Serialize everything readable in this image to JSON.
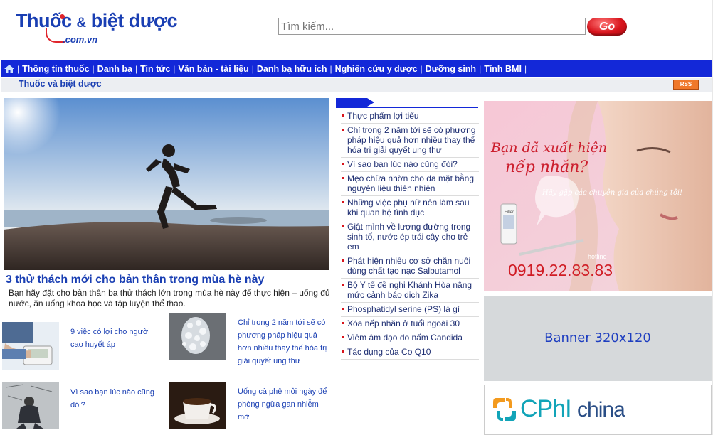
{
  "header": {
    "logo_brand": "Thuốc",
    "logo_amp": "&",
    "logo_rest": "biệt dược",
    "logo_sub": ".com.vn",
    "search_placeholder": "Tìm kiếm...",
    "search_button": "Go"
  },
  "nav": {
    "home_icon": "home-icon",
    "items": [
      "Thông tin thuốc",
      "Danh bạ",
      "Tin tức",
      "Văn bản - tài liệu",
      "Danh bạ hữu ích",
      "Nghiên cứu y dược",
      "Dưỡng sinh",
      "Tính BMI"
    ]
  },
  "breadcrumb": "Thuốc và biệt dược",
  "rss": "RSS",
  "feature": {
    "title": "3 thử thách mới cho bản thân trong mùa hè này",
    "summary": "Bạn hãy đặt cho bản thân ba thử thách lớn trong mùa hè này để thực hiện – uống đủ nước, ăn uống khoa học và tập luyện thể thao."
  },
  "small_articles": [
    {
      "title": "9 việc có lợi cho người cao huyết áp"
    },
    {
      "title": "Chỉ trong 2 năm tới sẽ có phương pháp hiệu quả hơn nhiều thay thế hóa trị giải quyết ung thư"
    },
    {
      "title": "Vì sao bạn lúc nào cũng đói?"
    },
    {
      "title": "Uống cà phê mỗi ngày để phòng ngừa gan nhiễm mỡ"
    }
  ],
  "news_list": [
    "Thực phẩm lợi tiểu",
    "Chỉ trong 2 năm tới sẽ có phương pháp hiệu quả hơn nhiều thay thế hóa trị giải quyết ung thư",
    "Vì sao bạn lúc nào cũng đói?",
    "Mẹo chữa nhờn cho da mặt bằng nguyên liệu thiên nhiên",
    "Những việc phụ nữ nên làm sau khi quan hệ tình dục",
    "Giật mình về lượng đường trong sinh tố, nước ép trái cây cho trẻ em",
    "Phát hiện nhiều cơ sở chăn nuôi dùng chất tạo nạc Salbutamol",
    "Bộ Y tế đề nghị Khánh Hòa nâng mức cảnh báo dịch Zika",
    "Phosphatidyl serine (PS) là gì",
    "Xóa nếp nhăn ở tuổi ngoài 30",
    "Viêm âm đạo do nấm Candida",
    "Tác dụng của Co Q10"
  ],
  "ads": {
    "top_line1": "Bạn đã xuất hiện",
    "top_line2": "nếp nhăn?",
    "top_bubble": "Hãy gặp các chuyên gia của chúng tôi!",
    "top_product": "Filler",
    "top_hotline_label": "hotline",
    "top_hotline": "0919.22.83.83",
    "mid_banner": "Banner 320x120",
    "bottom_brand": "CPhI",
    "bottom_brand2": "china"
  }
}
